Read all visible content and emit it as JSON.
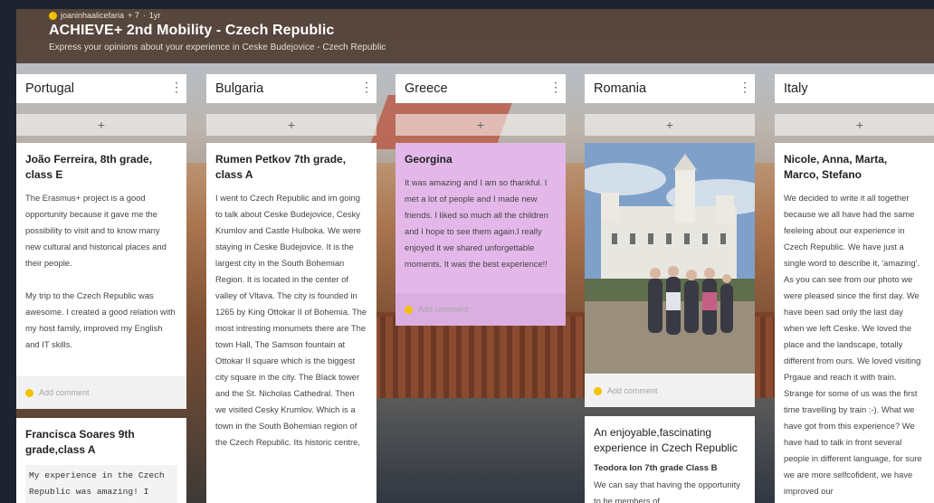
{
  "header": {
    "author": "joaninhaalicefaria",
    "plus_count": "+ 7",
    "age": "1yr",
    "title": "ACHIEVE+ 2nd Mobility - Czech Republic",
    "subtitle": "Express your opinions about your experience in Ceske Budejovice - Czech Republic"
  },
  "columns": [
    {
      "name": "Portugal"
    },
    {
      "name": "Bulgaria"
    },
    {
      "name": "Greece"
    },
    {
      "name": "Romania"
    },
    {
      "name": "Italy"
    }
  ],
  "ui": {
    "add_symbol": "+",
    "add_comment": "Add comment",
    "more_icon": "⋮",
    "accent": "#f2c200",
    "highlight_card": "#e3b8e9"
  },
  "cards": {
    "pt1": {
      "title": "João Ferreira, 8th grade, class E",
      "body": "The Erasmus+ project is a good opportunity because it gave me the possibility to visit and to know many new cultural and historical places and their people.\n\nMy trip to the Czech Republic was awesome. I created a good relation with my host family, improved my English and IT skills."
    },
    "pt2": {
      "title": "Francisca Soares 9th grade,class A",
      "body": "My experience in the Czech Republic was amazing! I"
    },
    "bg1": {
      "title": "Rumen Petkov 7th grade, class A",
      "body": "I went to Czech Republic and im going to talk about Ceske Budejovice, Cesky Krumlov and Castle Hulboka. We were staying in Ceske Budejovice. It is the largest city in the South Bohemian Region. It is located in the center of valley of Vltava. The city is founded in 1265 by King Ottokar II of Bohemia. The most intresting monumets there are The town Hall, The Samson fountain at Ottokar II square which is the biggest city square in the city. The Black tower and the St. Nicholas Cathedral. Then we visited Cesky Krumlov. Which is a town in the South Bohemian region of the Czech Republic. Its historic centre,"
    },
    "gr1": {
      "title": "Georgina",
      "body": "It was amazing and I am so thankful. I met a lot of people and I made new friends. I liked so much all the children and I hope to see them again.I really enjoyed it we shared unforgettable moments. It was the best experience!!"
    },
    "ro2": {
      "title": "An enjoyable,fascinating experience in Czech Republic",
      "subtitle": "Teodora Ion 7th grade Class B",
      "body": "We can say that having the opportunity to be members of"
    },
    "it1": {
      "title": "Nicole, Anna, Marta, Marco, Stefano",
      "body": "We decided to write it all together because we all have had the same feeleing about our experience in Czech Republic. We have just a single word to describe it, 'amazing'. As you can see from our photo we were pleased since the first day. We have been sad only the last day when we left Ceske. We loved the place and the landscape, totally different from ours. We loved visiting Prgaue and reach it with train. Strange for some of us was the first time travelling by train :-). What we have got from this experience? We have had to talk in front several people in different language, for sure we are more selfcofident, we have improved our"
    }
  }
}
